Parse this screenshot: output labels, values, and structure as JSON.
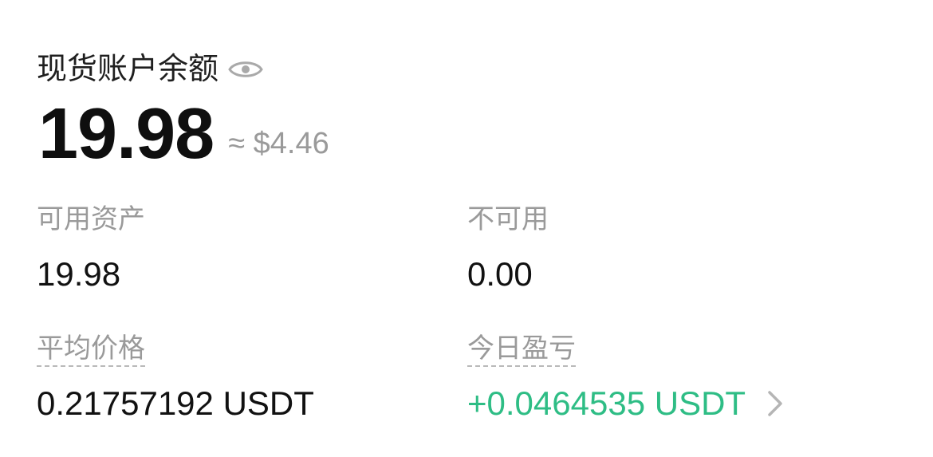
{
  "balance": {
    "title": "现货账户余额",
    "amount": "19.98",
    "fiat": "≈ $4.46"
  },
  "stats": {
    "available": {
      "label": "可用资产",
      "value": "19.98"
    },
    "unavailable": {
      "label": "不可用",
      "value": "0.00"
    },
    "avg_price": {
      "label": "平均价格",
      "value": "0.21757192 USDT"
    },
    "today_pnl": {
      "label": "今日盈亏",
      "value": "+0.0464535 USDT"
    }
  },
  "icons": {
    "visibility": "eye-icon",
    "detail": "chevron-right-icon"
  },
  "colors": {
    "positive": "#2ebd85",
    "muted": "#9a9a9a",
    "primary_text": "#111111"
  }
}
